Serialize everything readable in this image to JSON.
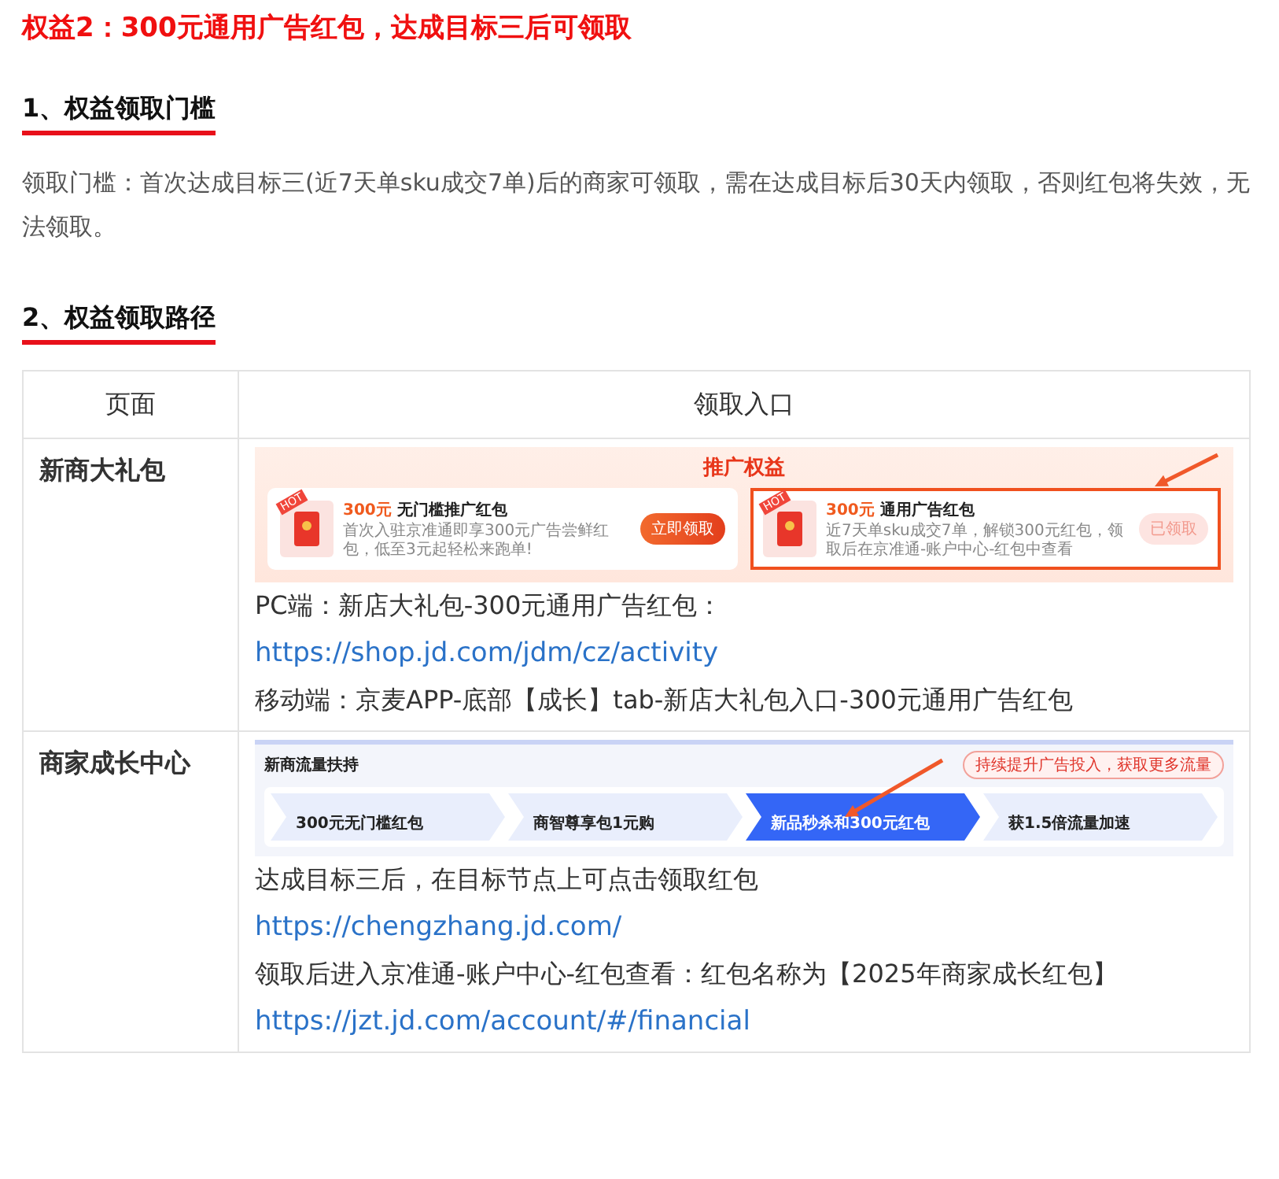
{
  "title": "权益2：300元通用广告红包，达成目标三后可领取",
  "sections": [
    {
      "heading": "1、权益领取门槛",
      "paragraph": "领取门槛：首次达成目标三(近7天单sku成交7单)后的商家可领取，需在达成目标后30天内领取，否则红包将失效，无法领取。"
    },
    {
      "heading": "2、权益领取路径"
    }
  ],
  "table": {
    "columns": [
      "页面",
      "领取入口"
    ],
    "rows": [
      {
        "page": "新商大礼包",
        "screenshot": {
          "kind": "benefits",
          "title": "推广权益",
          "cards": [
            {
              "badge": "HOT",
              "amount": "300元",
              "name": "无门槛推广红包",
              "desc": "首次入驻京准通即享300元广告尝鲜红包，低至3元起轻松来跑单!",
              "button": "立即领取",
              "claimed": false,
              "highlighted": false
            },
            {
              "badge": "HOT",
              "amount": "300元",
              "name": "通用广告红包",
              "desc": "近7天单sku成交7单，解锁300元红包，领取后在京准通-账户中心-红包中查看",
              "button": "已领取",
              "claimed": true,
              "highlighted": true
            }
          ]
        },
        "lines": [
          {
            "kind": "text",
            "text": "PC端：新店大礼包-300元通用广告红包："
          },
          {
            "kind": "link",
            "text": "https://shop.jd.com/jdm/cz/activity"
          },
          {
            "kind": "text",
            "text": "移动端：京麦APP-底部【成长】tab-新店大礼包入口-300元通用广告红包"
          }
        ]
      },
      {
        "page": "商家成长中心",
        "screenshot": {
          "kind": "progress",
          "title": "新商流量扶持",
          "notice": "持续提升广告投入，获取更多流量",
          "steps": [
            {
              "value": "300元无门槛红包",
              "current": false
            },
            {
              "value": "商智尊享包1元购",
              "current": false
            },
            {
              "value": "新品秒杀和300元红包",
              "current": true
            },
            {
              "value": "获1.5倍流量加速",
              "current": false
            }
          ]
        },
        "lines": [
          {
            "kind": "text",
            "text": "达成目标三后，在目标节点上可点击领取红包"
          },
          {
            "kind": "link",
            "text": "https://chengzhang.jd.com/"
          },
          {
            "kind": "text",
            "text": "领取后进入京准通-账户中心-红包查看：红包名称为【2025年商家成长红包】"
          },
          {
            "kind": "link",
            "text": "https://jzt.jd.com/account/#/financial"
          }
        ]
      }
    ]
  }
}
